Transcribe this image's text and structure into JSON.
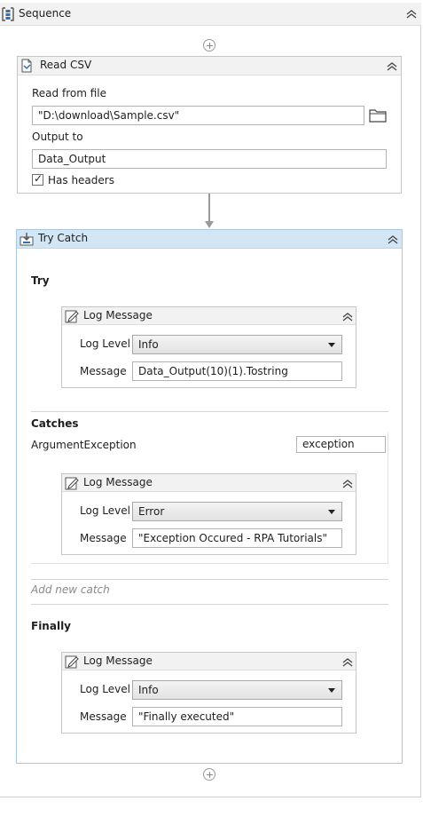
{
  "sequence": {
    "title": "Sequence"
  },
  "read_csv": {
    "title": "Read CSV",
    "read_from_label": "Read from file",
    "file_value": "\"D:\\download\\Sample.csv\"",
    "output_label": "Output to",
    "output_value": "Data_Output",
    "has_headers_label": "Has headers",
    "has_headers_checked": true
  },
  "try_catch": {
    "title": "Try Catch",
    "try_label": "Try",
    "catches_label": "Catches",
    "exception_type": "ArgumentException",
    "exception_var": "exception",
    "add_new_catch": "Add new catch",
    "finally_label": "Finally"
  },
  "log_try": {
    "title": "Log Message",
    "level_label": "Log Level",
    "level_value": "Info",
    "message_label": "Message",
    "message_value": "Data_Output(10)(1).Tostring"
  },
  "log_catch": {
    "title": "Log Message",
    "level_label": "Log Level",
    "level_value": "Error",
    "message_label": "Message",
    "message_value": "\"Exception Occured - RPA Tutorials\""
  },
  "log_finally": {
    "title": "Log Message",
    "level_label": "Log Level",
    "level_value": "Info",
    "message_label": "Message",
    "message_value": "\"Finally executed\""
  },
  "colors": {
    "header_bg": "#f2f2f2",
    "selected_header_bg": "#d3e6f5",
    "border": "#c6c6c6",
    "icon_blue": "#2f6fb5"
  },
  "icons": {
    "sequence": "sequence-icon",
    "read_csv": "read-csv-icon",
    "try_catch": "try-catch-icon",
    "log": "log-message-icon",
    "collapse": "collapse-chevron-icon",
    "folder": "folder-icon",
    "add": "add-activity-icon"
  }
}
